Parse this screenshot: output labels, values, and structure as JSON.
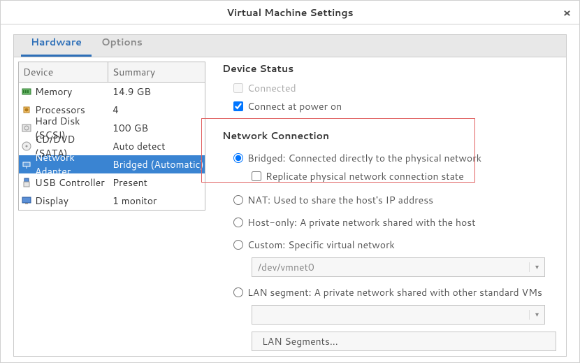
{
  "window": {
    "title": "Virtual Machine Settings"
  },
  "tabs": {
    "hardware": "Hardware",
    "options": "Options"
  },
  "grid": {
    "headers": {
      "device": "Device",
      "summary": "Summary"
    },
    "rows": [
      {
        "name": "Memory",
        "summary": "14.9 GB"
      },
      {
        "name": "Processors",
        "summary": "4"
      },
      {
        "name": "Hard Disk (SCSI)",
        "summary": "100 GB"
      },
      {
        "name": "CD/DVD (SATA)",
        "summary": "Auto detect"
      },
      {
        "name": "Network Adapter",
        "summary": "Bridged (Automatic)"
      },
      {
        "name": "USB Controller",
        "summary": "Present"
      },
      {
        "name": "Display",
        "summary": "1 monitor"
      }
    ]
  },
  "device_status": {
    "title": "Device Status",
    "connected": "Connected",
    "connect_power_on": "Connect at power on"
  },
  "network": {
    "title": "Network Connection",
    "bridged": "Bridged: Connected directly to the physical network",
    "replicate": "Replicate physical network connection state",
    "nat": "NAT: Used to share the host's IP address",
    "hostonly": "Host-only: A private network shared with the host",
    "custom": "Custom: Specific virtual network",
    "custom_value": "/dev/vmnet0",
    "lansegment": "LAN segment: A private network shared with other standard VMs",
    "lan_button": "LAN Segments..."
  }
}
